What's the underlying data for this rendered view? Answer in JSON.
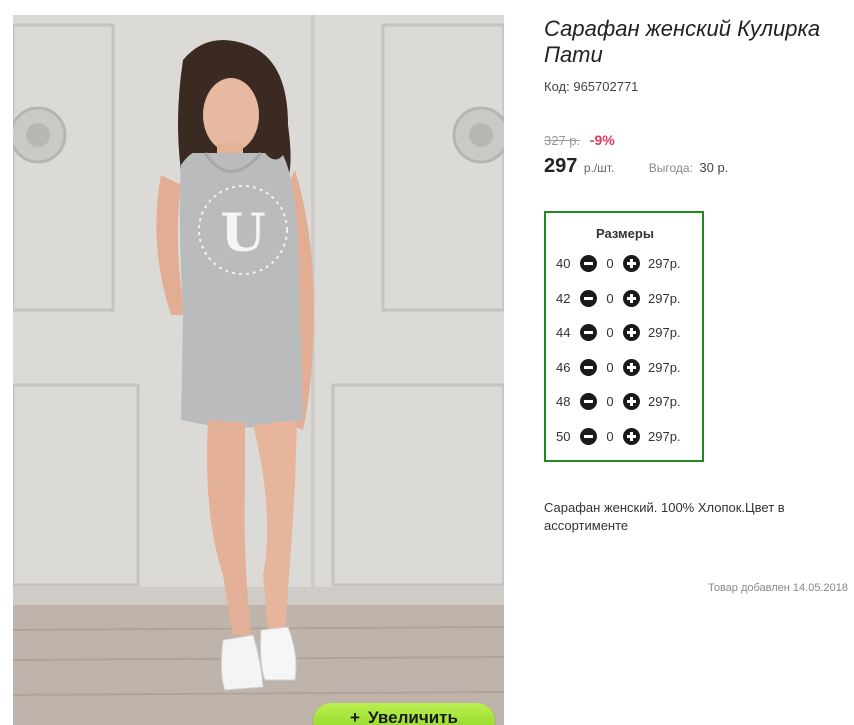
{
  "product": {
    "title": "Сарафан женский Кулирка Пати",
    "sku_label": "Код:",
    "sku": "965702771",
    "old_price": "327 р.",
    "discount": "-9%",
    "price": "297",
    "price_unit": "р./шт.",
    "saving_label": "Выгода:",
    "saving_value": "30 р.",
    "description": "Сарафан женский. 100% Хлопок.Цвет в ассортименте",
    "added": "Товар добавлен 14.05.2018"
  },
  "image": {
    "zoom_label": "Увеличить",
    "zoom_icon": "plus-icon",
    "shirt_print": "U"
  },
  "sizes": {
    "title": "Размеры",
    "rows": [
      {
        "size": "40",
        "qty": "0",
        "price": "297р."
      },
      {
        "size": "42",
        "qty": "0",
        "price": "297р."
      },
      {
        "size": "44",
        "qty": "0",
        "price": "297р."
      },
      {
        "size": "46",
        "qty": "0",
        "price": "297р."
      },
      {
        "size": "48",
        "qty": "0",
        "price": "297р."
      },
      {
        "size": "50",
        "qty": "0",
        "price": "297р."
      }
    ]
  },
  "colors": {
    "border_green": "#1f8a1f",
    "discount_red": "#e0395d",
    "zoom_green": "#8bd21d"
  }
}
